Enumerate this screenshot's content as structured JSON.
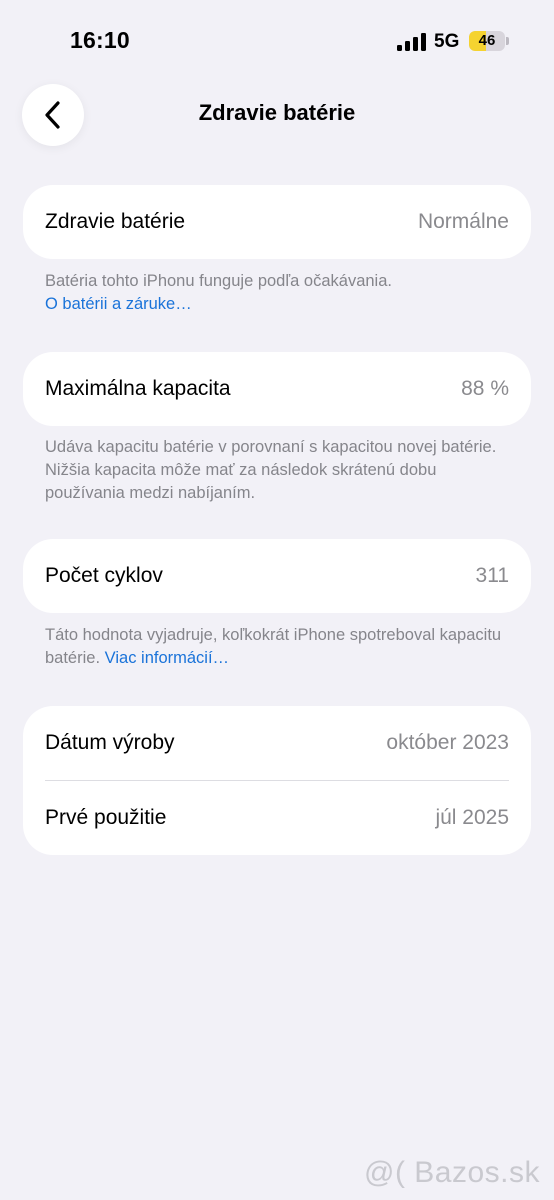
{
  "status_bar": {
    "time": "16:10",
    "network": "5G",
    "battery_percent": "46",
    "battery_level": 0.46
  },
  "nav": {
    "title": "Zdravie batérie"
  },
  "health": {
    "label": "Zdravie batérie",
    "value": "Normálne"
  },
  "health_note": {
    "text": "Batéria tohto iPhonu funguje podľa očakávania.",
    "link": "O batérii a záruke…"
  },
  "capacity": {
    "label": "Maximálna kapacita",
    "value": "88 %"
  },
  "capacity_note": {
    "text": "Udáva kapacitu batérie v porovnaní s kapacitou novej batérie. Nižšia kapacita môže mať za následok skrátenú dobu používania medzi nabíjaním."
  },
  "cycles": {
    "label": "Počet cyklov",
    "value": "311"
  },
  "cycles_note": {
    "text": "Táto hodnota vyjadruje, koľkokrát iPhone spotreboval kapacitu batérie.",
    "link": "Viac informácií…"
  },
  "dates": {
    "manufacture_label": "Dátum výroby",
    "manufacture_value": "október 2023",
    "first_use_label": "Prvé použitie",
    "first_use_value": "júl 2025"
  },
  "watermark": "@( Bazos.sk",
  "colors": {
    "background": "#f2f1f7",
    "link": "#1a73d9",
    "battery_fill": "#f5d330"
  }
}
